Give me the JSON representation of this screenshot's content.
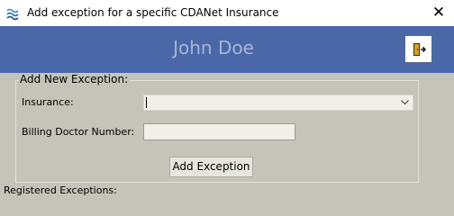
{
  "window": {
    "title": "Add exception for a specific CDANet Insurance",
    "app_icon": "cdanet-waves-icon",
    "close_glyph": "✕"
  },
  "header": {
    "user_name": "John Doe",
    "exit_icon": "exit-door-icon",
    "band_color": "#4a67a8"
  },
  "form": {
    "group_title": "Add New Exception:",
    "insurance_label": "Insurance:",
    "insurance_value": "",
    "billing_doctor_label": "Billing Doctor Number:",
    "billing_doctor_value": "",
    "add_button_label": "Add Exception"
  },
  "footer": {
    "registered_label": "Registered Exceptions:"
  }
}
